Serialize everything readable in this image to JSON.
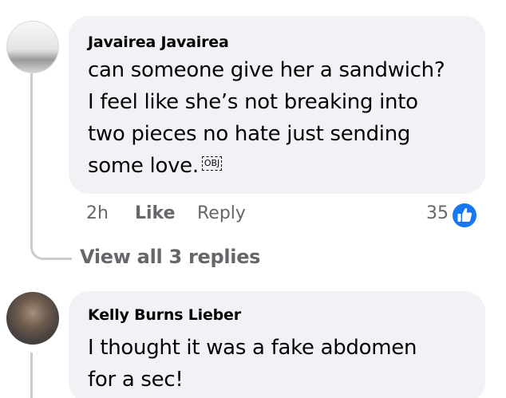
{
  "comments": [
    {
      "author": "Javairea Javairea",
      "body_lines": [
        "can someone give her a sandwich?",
        "I feel like she’s not breaking into",
        "two pieces no hate just sending",
        "some love."
      ],
      "inline_object_label": "OBJ",
      "time": "2h",
      "like_label": "Like",
      "reply_label": "Reply",
      "reaction_count": "35",
      "reaction_icon": "like-thumb-icon",
      "view_replies_label": "View all 3 replies"
    },
    {
      "author": "Kelly Burns Lieber",
      "body_lines": [
        "I thought it was a fake abdomen",
        "for a sec!"
      ]
    }
  ],
  "colors": {
    "bubble": "#f0f2f5",
    "text": "#050505",
    "meta": "#65676b",
    "like_blue": "#1877f2",
    "thread_line": "#c9ccd1"
  }
}
